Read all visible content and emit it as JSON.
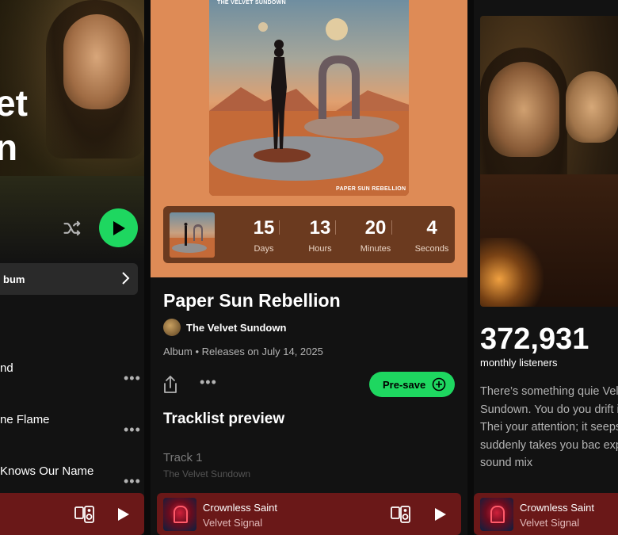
{
  "left_panel": {
    "title_partial": "et\nn",
    "tracks": [
      {
        "label": "nd"
      },
      {
        "label": "ne Flame"
      },
      {
        "label": "Knows Our Name"
      }
    ],
    "album_row_label": "bum"
  },
  "center_panel": {
    "cover_top_caption": "THE VELVET SUNDOWN",
    "cover_bottom_caption": "PAPER SUN REBELLION",
    "countdown": [
      {
        "value": "15",
        "unit": "Days"
      },
      {
        "value": "13",
        "unit": "Hours"
      },
      {
        "value": "20",
        "unit": "Minutes"
      },
      {
        "value": "4",
        "unit": "Seconds"
      }
    ],
    "album_title": "Paper Sun Rebellion",
    "artist": "The Velvet Sundown",
    "meta": "Album • Releases on July 14, 2025",
    "presave_label": "Pre-save",
    "tracklist_heading": "Tracklist preview",
    "track1_title": "Track 1",
    "track1_artist": "The Velvet Sundown"
  },
  "right_panel": {
    "listeners_count": "372,931",
    "listeners_label": "monthly listeners",
    "bio": "There’s something quie Velvet Sundown. You do you drift into them. Thei your attention; it seeps suddenly takes you bac expect. Their sound mix"
  },
  "now_playing": {
    "title": "Crownless Saint",
    "artist": "Velvet Signal"
  },
  "colors": {
    "accent_green": "#1ed760",
    "mini_player_bg": "#6a1818",
    "center_header_bg": "#de8b56",
    "countdown_bg": "#6b3a1f"
  },
  "icons": [
    "shuffle-icon",
    "play-icon",
    "chevron-right-icon",
    "more-icon",
    "share-icon",
    "add-circle-icon",
    "connect-device-icon"
  ]
}
